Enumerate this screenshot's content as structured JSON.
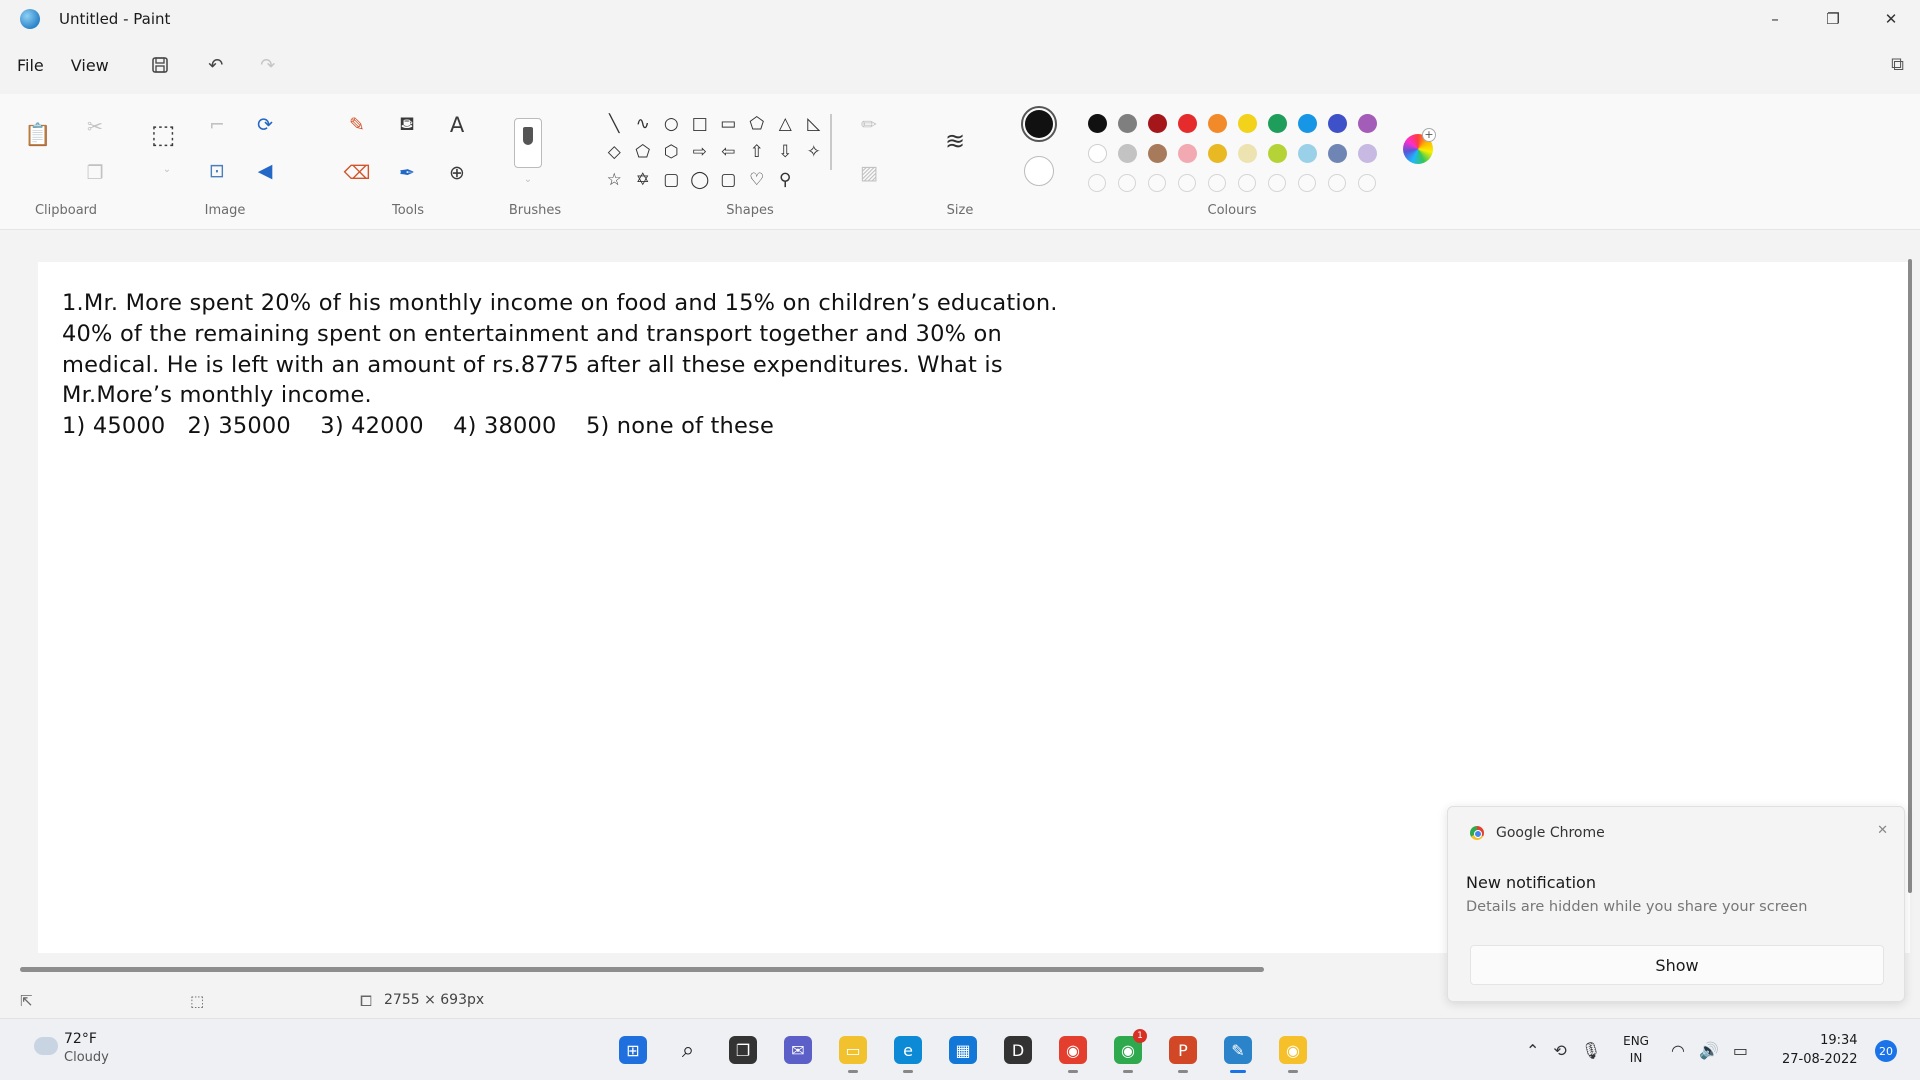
{
  "window": {
    "title": "Untitled - Paint",
    "controls": {
      "minimize": "–",
      "maximize": "❐",
      "close": "✕"
    }
  },
  "menu": {
    "file": "File",
    "view": "View",
    "icons": [
      "save-icon",
      "undo-icon",
      "redo-icon"
    ]
  },
  "ribbon": {
    "groups": {
      "clipboard": "Clipboard",
      "image": "Image",
      "tools": "Tools",
      "brushes": "Brushes",
      "shapes": "Shapes",
      "size": "Size",
      "colours": "Colours"
    },
    "shapes": [
      "╲",
      "∿",
      "○",
      "□",
      "▭",
      "⬠",
      "△",
      "◺",
      "◇",
      "⬠",
      "⬡",
      "⇨",
      "⇦",
      "⇧",
      "⇩",
      "✧",
      "☆",
      "✡",
      "▢",
      "◯",
      "▢",
      "♡",
      "⚲"
    ],
    "primary_color": "#111111",
    "secondary_color": "#ffffff",
    "palette_row1": [
      "#111111",
      "#7f7f7f",
      "#a4161a",
      "#e52b2b",
      "#f28a2a",
      "#f2d21b",
      "#1e9e5a",
      "#1796e6",
      "#3f51c8",
      "#a35cb8"
    ],
    "palette_row2": [
      "#ffffff",
      "#c3c3c3",
      "#a87a5c",
      "#f2a9b1",
      "#e8b923",
      "#ece3b0",
      "#b5d336",
      "#9ad0e8",
      "#6f86b5",
      "#c7b9e2"
    ]
  },
  "canvas": {
    "question_lines": [
      "1.Mr. More spent 20% of his monthly income on food and 15% on children’s education.",
      "40% of the remaining spent on entertainment and transport together and 30% on",
      "medical. He is left with an amount of rs.8775 after all these expenditures. What is",
      "Mr.More’s monthly income.",
      "1) 45000   2) 35000    3) 42000    4) 38000    5) none of these"
    ]
  },
  "statusbar": {
    "dimensions": "2755 × 693px"
  },
  "notification": {
    "app": "Google Chrome",
    "title": "New notification",
    "body": "Details are hidden while you share your screen",
    "button": "Show"
  },
  "taskbar": {
    "weather_temp": "72°F",
    "weather_desc": "Cloudy",
    "apps": [
      {
        "name": "start",
        "color": "#1f6fde",
        "glyph": "⊞"
      },
      {
        "name": "search",
        "color": "transparent",
        "glyph": "⌕"
      },
      {
        "name": "task-view",
        "color": "#333333",
        "glyph": "❐"
      },
      {
        "name": "teams-chat",
        "color": "#5b5fc7",
        "glyph": "✉"
      },
      {
        "name": "file-explorer",
        "color": "#f2c12e",
        "glyph": "▭"
      },
      {
        "name": "edge",
        "color": "#0c8ad6",
        "glyph": "e"
      },
      {
        "name": "store",
        "color": "#1277d6",
        "glyph": "▦"
      },
      {
        "name": "dell",
        "color": "#333333",
        "glyph": "D"
      },
      {
        "name": "chrome-1",
        "color": "#e43f2e",
        "glyph": "◉"
      },
      {
        "name": "chrome-2",
        "color": "#2fa94e",
        "glyph": "◉"
      },
      {
        "name": "powerpoint",
        "color": "#d24726",
        "glyph": "P"
      },
      {
        "name": "paint",
        "color": "#2b84c9",
        "glyph": "✎"
      },
      {
        "name": "chrome-3",
        "color": "#f6c02a",
        "glyph": "◉"
      }
    ],
    "badge": "1",
    "lang_line1": "ENG",
    "lang_line2": "IN",
    "time": "19:34",
    "date": "27-08-2022",
    "notification_count": "20"
  }
}
